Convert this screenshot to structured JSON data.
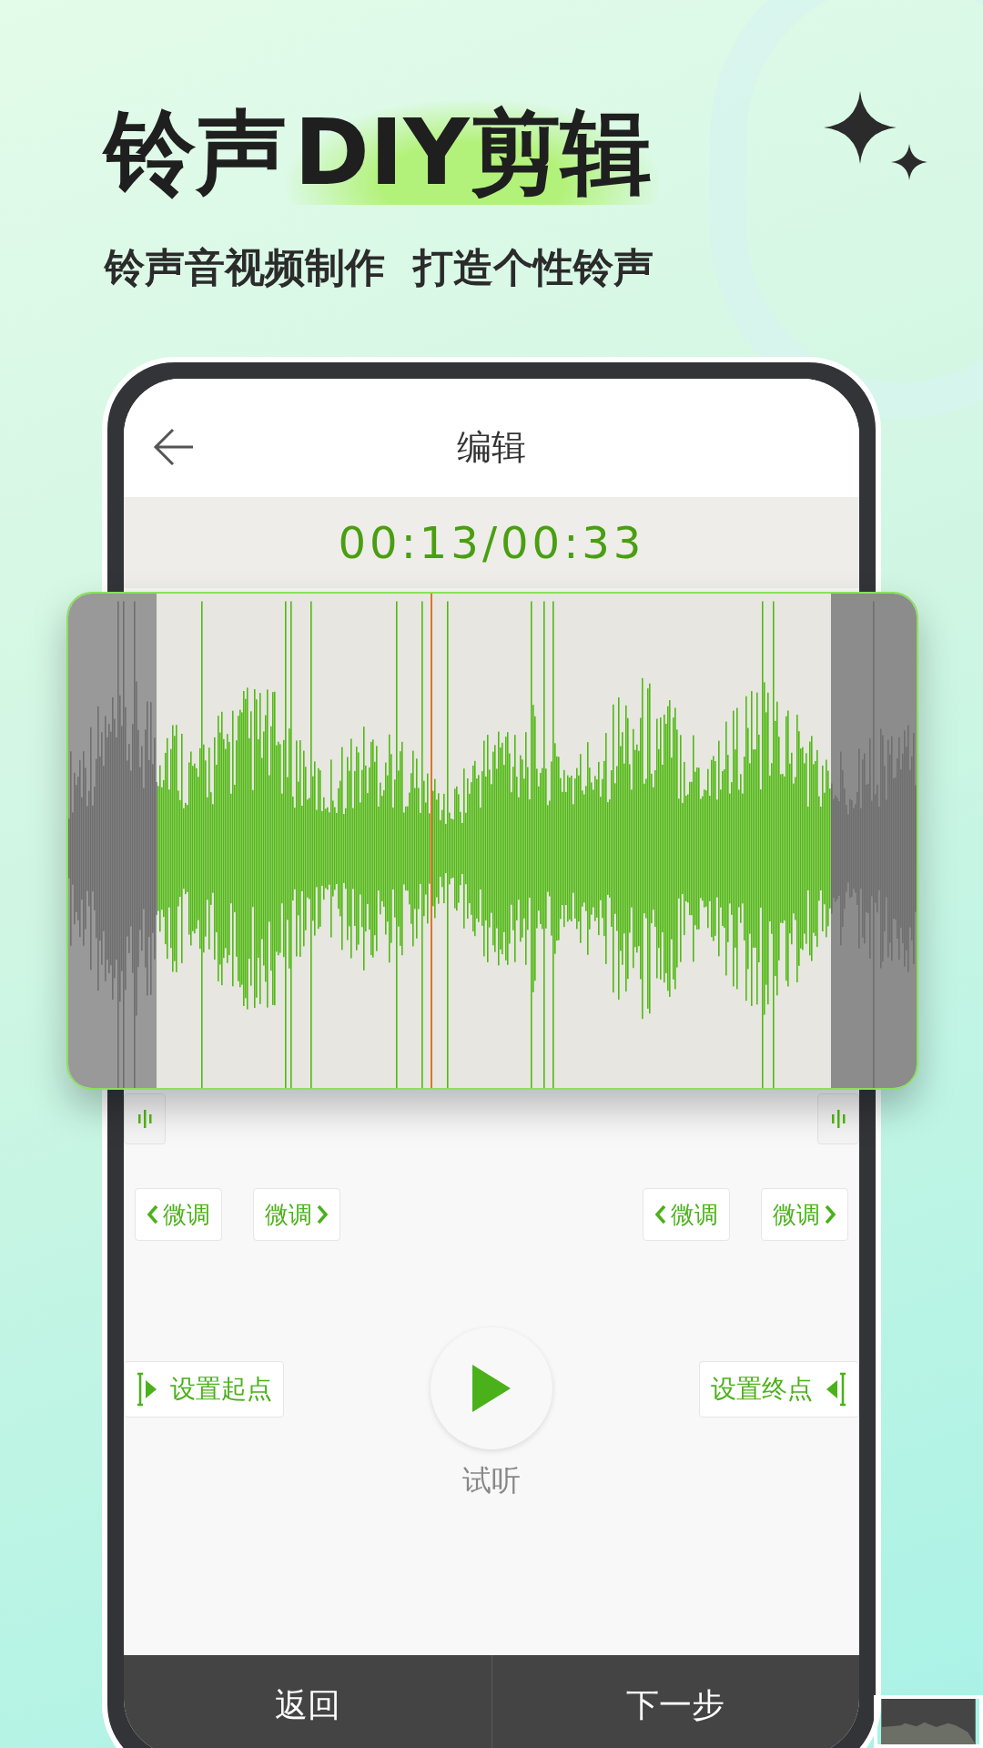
{
  "headline": {
    "parts": [
      {
        "text": "铃声",
        "highlighted": false
      },
      {
        "text": "DIY剪辑",
        "highlighted": true
      }
    ],
    "subtitle": "铃声音视频制作  打造个性铃声"
  },
  "screen": {
    "title": "编辑",
    "time": "00:13/00:33",
    "fine_tune": [
      {
        "label": "微调",
        "kind": "left"
      },
      {
        "label": "微调",
        "kind": "right"
      },
      {
        "label": "微调",
        "kind": "left"
      },
      {
        "label": "微调",
        "kind": "right"
      }
    ],
    "set_start": "设置起点",
    "set_end": "设置终点",
    "play_label": "试听",
    "bottom_buttons": [
      "返回",
      "下一步"
    ]
  }
}
